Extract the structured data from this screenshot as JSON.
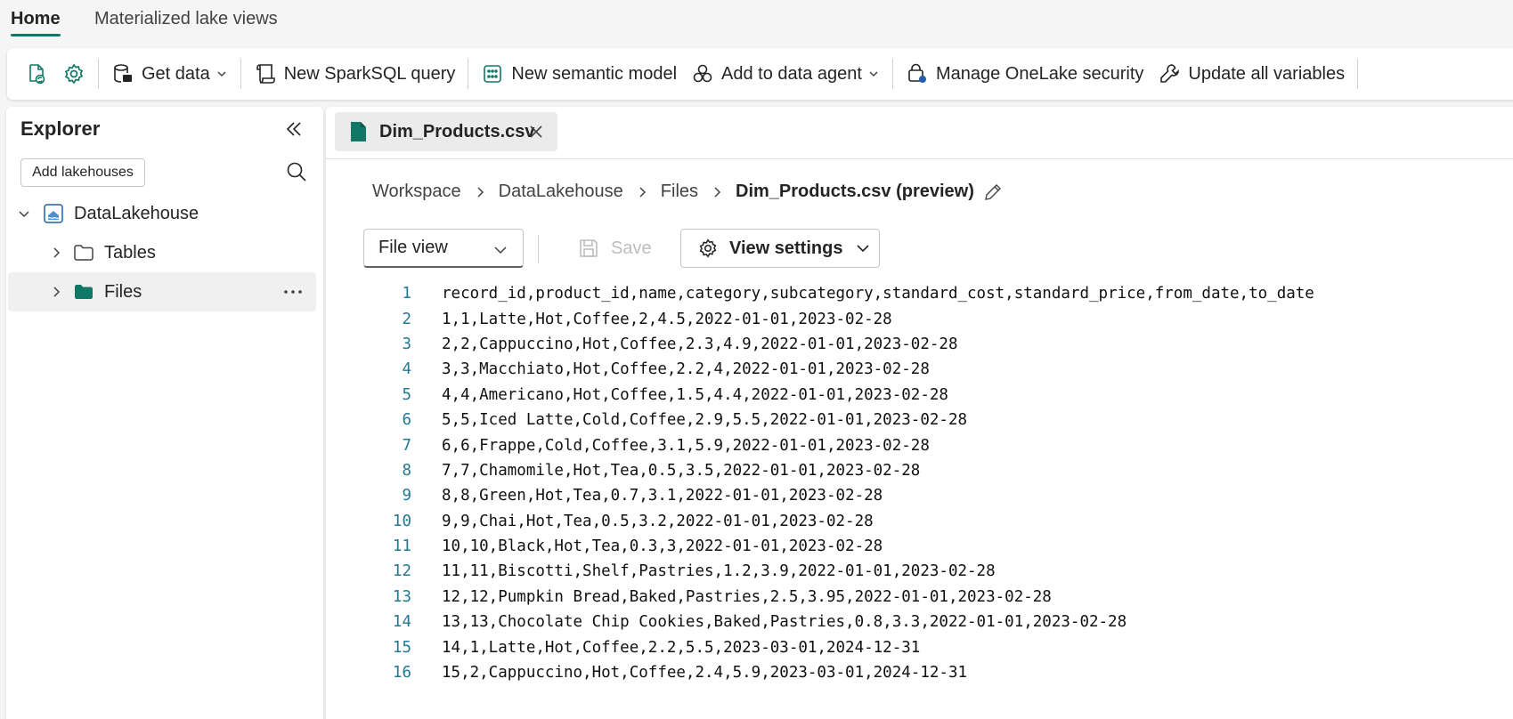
{
  "top_tabs": [
    {
      "label": "Home",
      "active": true
    },
    {
      "label": "Materialized lake views",
      "active": false
    }
  ],
  "ribbon": {
    "items": [
      {
        "icon": "refresh-lakehouse-icon",
        "label": ""
      },
      {
        "icon": "gear-icon",
        "label": ""
      },
      {
        "icon": "database-icon",
        "label": "Get data",
        "caret": true
      },
      {
        "icon": "sparksql-query-icon",
        "label": "New SparkSQL query"
      },
      {
        "icon": "semantic-model-icon",
        "label": "New semantic model"
      },
      {
        "icon": "data-agent-icon",
        "label": "Add to data agent",
        "caret": true
      },
      {
        "icon": "onelake-security-icon",
        "label": "Manage OneLake security"
      },
      {
        "icon": "variables-icon",
        "label": "Update all variables"
      }
    ]
  },
  "explorer": {
    "title": "Explorer",
    "add_lakehouses": "Add lakehouses",
    "tree": [
      {
        "label": "DataLakehouse",
        "level": 0,
        "expanded": true
      },
      {
        "label": "Tables",
        "level": 1
      },
      {
        "label": "Files",
        "level": 1,
        "selected": true
      }
    ]
  },
  "file_tab": {
    "label": "Dim_Products.csv"
  },
  "breadcrumb": [
    "Workspace",
    "DataLakehouse",
    "Files",
    "Dim_Products.csv (preview)"
  ],
  "toolbar": {
    "view_select": "File view",
    "save": "Save",
    "view_settings": "View settings"
  },
  "colors": {
    "accent": "#117865",
    "line_number": "#237893"
  },
  "file_lines": [
    "record_id,product_id,name,category,subcategory,standard_cost,standard_price,from_date,to_date",
    "1,1,Latte,Hot,Coffee,2,4.5,2022-01-01,2023-02-28",
    "2,2,Cappuccino,Hot,Coffee,2.3,4.9,2022-01-01,2023-02-28",
    "3,3,Macchiato,Hot,Coffee,2.2,4,2022-01-01,2023-02-28",
    "4,4,Americano,Hot,Coffee,1.5,4.4,2022-01-01,2023-02-28",
    "5,5,Iced Latte,Cold,Coffee,2.9,5.5,2022-01-01,2023-02-28",
    "6,6,Frappe,Cold,Coffee,3.1,5.9,2022-01-01,2023-02-28",
    "7,7,Chamomile,Hot,Tea,0.5,3.5,2022-01-01,2023-02-28",
    "8,8,Green,Hot,Tea,0.7,3.1,2022-01-01,2023-02-28",
    "9,9,Chai,Hot,Tea,0.5,3.2,2022-01-01,2023-02-28",
    "10,10,Black,Hot,Tea,0.3,3,2022-01-01,2023-02-28",
    "11,11,Biscotti,Shelf,Pastries,1.2,3.9,2022-01-01,2023-02-28",
    "12,12,Pumpkin Bread,Baked,Pastries,2.5,3.95,2022-01-01,2023-02-28",
    "13,13,Chocolate Chip Cookies,Baked,Pastries,0.8,3.3,2022-01-01,2023-02-28",
    "14,1,Latte,Hot,Coffee,2.2,5.5,2023-03-01,2024-12-31",
    "15,2,Cappuccino,Hot,Coffee,2.4,5.9,2023-03-01,2024-12-31"
  ],
  "line_numbers": [
    "1",
    "2",
    "3",
    "4",
    "5",
    "6",
    "7",
    "8",
    "9",
    "10",
    "11",
    "12",
    "13",
    "14",
    "15",
    "16"
  ]
}
